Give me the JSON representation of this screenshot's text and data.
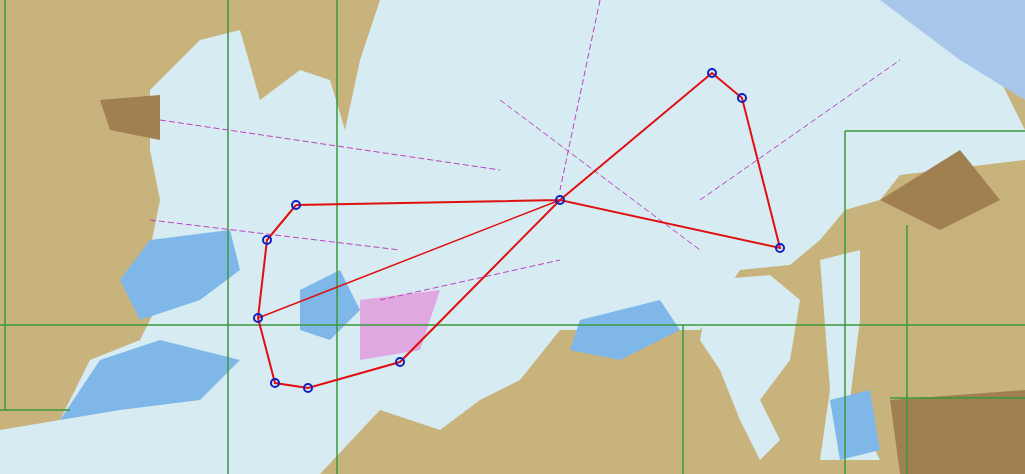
{
  "chart": {
    "kind": "nautical",
    "route_visible": true
  }
}
